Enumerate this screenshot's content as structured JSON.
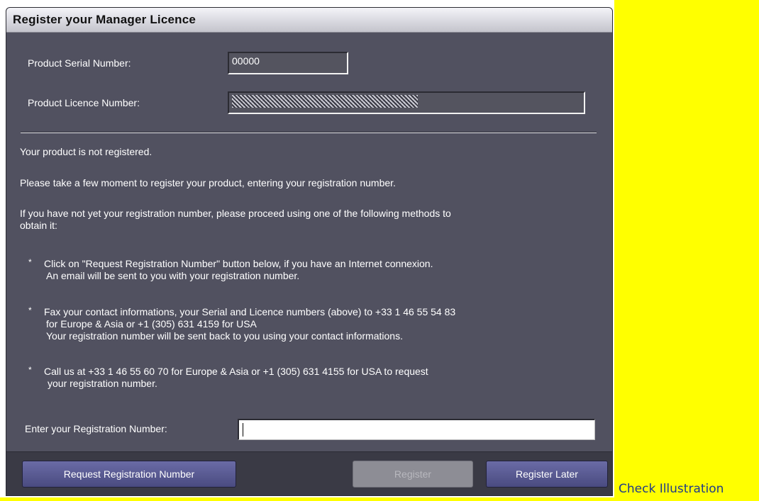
{
  "dialog": {
    "title": "Register your Manager Licence",
    "serial_label": "Product Serial Number:",
    "serial_value": "00000",
    "licence_label": "Product Licence Number:",
    "status_text": "Your product is not registered.",
    "intro_text": "Please take a few moment to register your product, entering your registration number.",
    "methods_line1": "If you have not yet your registration number, please proceed using one of the following methods to",
    "methods_line2": "obtain it:",
    "bullets": [
      {
        "star": "*",
        "lines": [
          "Click on \"Request Registration Number\" button below, if you have an Internet connexion.",
          "An email will be sent to you with your registration number."
        ]
      },
      {
        "star": "*",
        "lines": [
          "Fax your contact informations, your Serial and Licence numbers (above) to +33 1 46 55 54 83",
          "for Europe & Asia or +1 (305) 631 4159 for USA",
          "Your registration number will be sent back to you using your contact informations."
        ]
      },
      {
        "star": "*",
        "lines": [
          "Call us at +33 1 46 55 60 70 for Europe & Asia or +1 (305) 631 4155 for USA to request",
          "your registration number."
        ]
      }
    ],
    "registration_label": "Enter your Registration Number:",
    "registration_value": "",
    "buttons": {
      "request": "Request Registration Number",
      "register": "Register",
      "later": "Register Later"
    }
  },
  "side_caption": "Check Illustration",
  "colors": {
    "highlight": "#ffff00",
    "dialog_bg": "#515160",
    "button_bg": "#5a5b93"
  }
}
